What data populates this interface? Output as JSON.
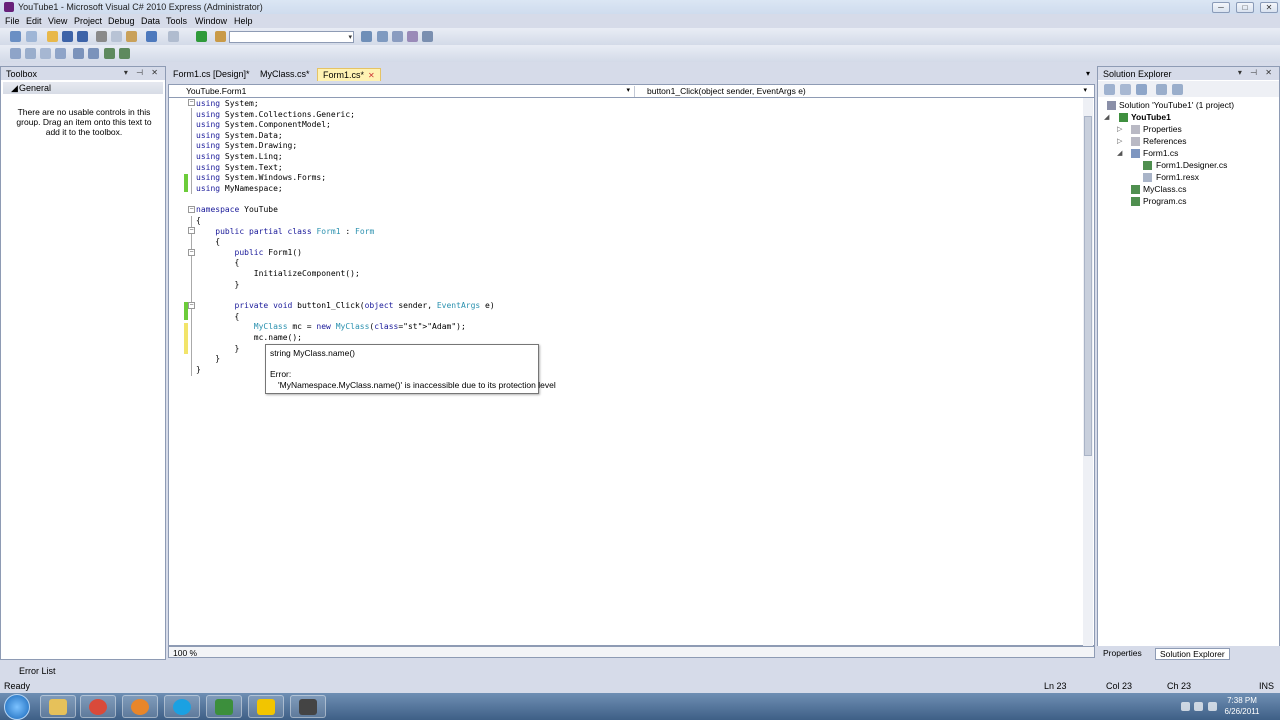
{
  "window": {
    "title": "YouTube1 - Microsoft Visual C# 2010 Express (Administrator)",
    "min_label": "─",
    "max_label": "□",
    "close_label": "✕"
  },
  "menu": [
    "File",
    "Edit",
    "View",
    "Project",
    "Debug",
    "Data",
    "Tools",
    "Window",
    "Help"
  ],
  "toolbox": {
    "title": "Toolbox",
    "group_label": "General",
    "empty_message": "There are no usable controls in this group. Drag an item onto this text to add it to the toolbox."
  },
  "editor": {
    "tabs": [
      {
        "label": "Form1.cs [Design]*"
      },
      {
        "label": "MyClass.cs*"
      },
      {
        "label": "Form1.cs*"
      }
    ],
    "nav_left": "YouTube.Form1",
    "nav_right": "button1_Click(object sender, EventArgs e)",
    "code": [
      "using System;",
      "using System.Collections.Generic;",
      "using System.ComponentModel;",
      "using System.Data;",
      "using System.Drawing;",
      "using System.Linq;",
      "using System.Text;",
      "using System.Windows.Forms;",
      "using MyNamespace;",
      "",
      "namespace YouTube",
      "{",
      "    public partial class Form1 : Form",
      "    {",
      "        public Form1()",
      "        {",
      "            InitializeComponent();",
      "        }",
      "",
      "        private void button1_Click(object sender, EventArgs e)",
      "        {",
      "            MyClass mc = new MyClass(\"Adam\");",
      "            mc.name();",
      "        }",
      "    }",
      "}"
    ],
    "tooltip": {
      "signature": "string MyClass.name()",
      "error_label": "Error:",
      "error_message": "'MyNamespace.MyClass.name()' is inaccessible due to its protection level"
    },
    "zoom": "100 %"
  },
  "solution_explorer": {
    "title": "Solution Explorer",
    "items": [
      {
        "label": "Solution 'YouTube1' (1 project)",
        "bold": false
      },
      {
        "label": "YouTube1",
        "bold": true
      },
      {
        "label": "Properties",
        "bold": false
      },
      {
        "label": "References",
        "bold": false
      },
      {
        "label": "Form1.cs",
        "bold": false
      },
      {
        "label": "Form1.Designer.cs",
        "bold": false
      },
      {
        "label": "Form1.resx",
        "bold": false
      },
      {
        "label": "MyClass.cs",
        "bold": false
      },
      {
        "label": "Program.cs",
        "bold": false
      }
    ],
    "tab_properties": "Properties",
    "tab_solution": "Solution Explorer"
  },
  "error_list": {
    "label": "Error List"
  },
  "status": {
    "ready": "Ready",
    "ln": "Ln 23",
    "col": "Col 23",
    "ch": "Ch 23",
    "ins": "INS"
  },
  "taskbar": {
    "time": "7:38 PM",
    "date": "6/26/2011"
  },
  "colors": {
    "keyword": "#1a1a9a",
    "type": "#2b91af",
    "string": "#a31515"
  }
}
